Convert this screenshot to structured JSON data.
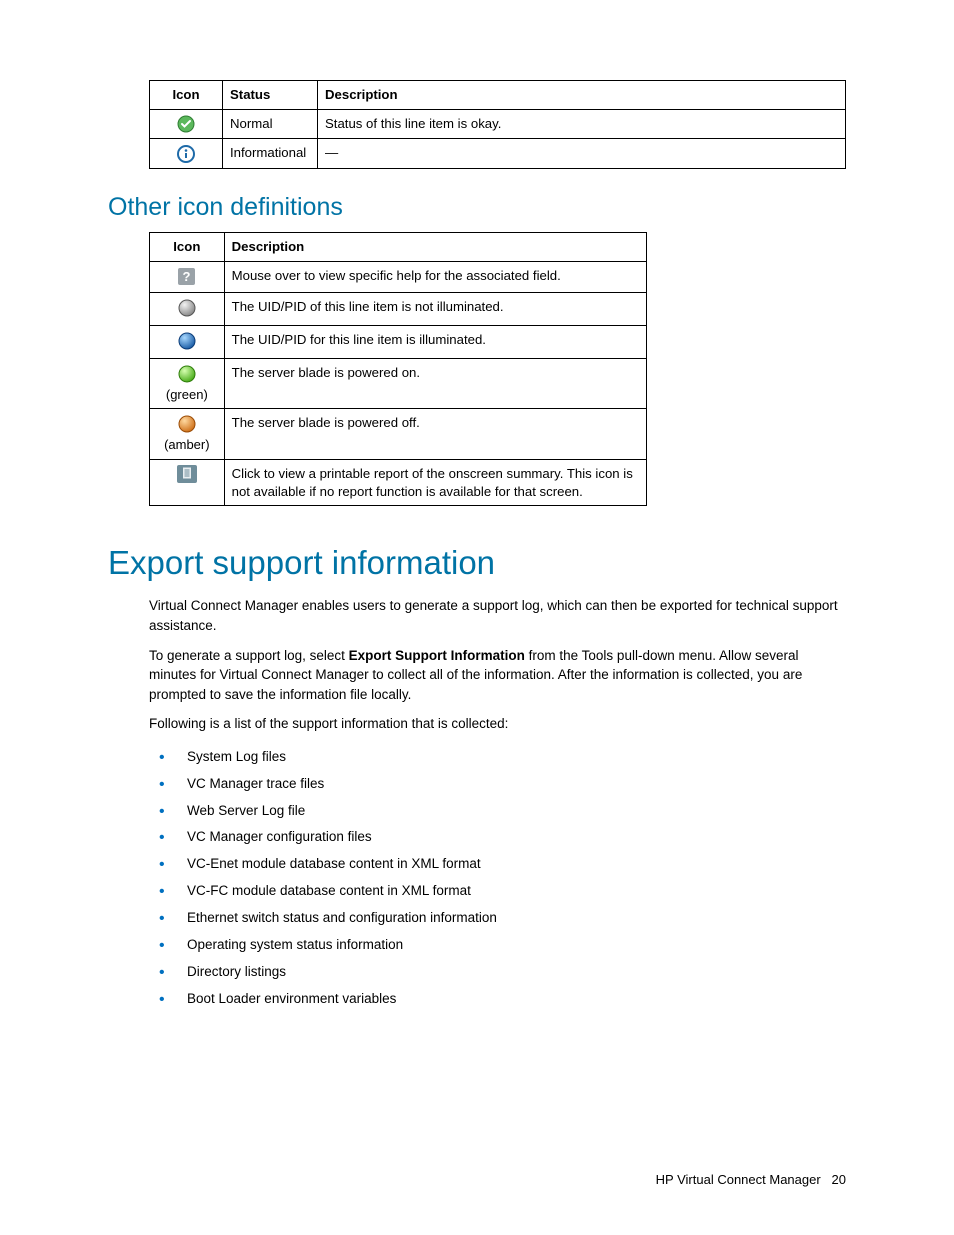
{
  "table1": {
    "headers": {
      "icon": "Icon",
      "status": "Status",
      "desc": "Description"
    },
    "rows": [
      {
        "status": "Normal",
        "desc": "Status of this line item is okay."
      },
      {
        "status": "Informational",
        "desc": "—"
      }
    ]
  },
  "section_other_title": "Other icon definitions",
  "table2": {
    "headers": {
      "icon": "Icon",
      "desc": "Description"
    },
    "rows": [
      {
        "note": "",
        "desc": "Mouse over to view specific help for the associated field."
      },
      {
        "note": "",
        "desc": "The UID/PID of this line item is not illuminated."
      },
      {
        "note": "",
        "desc": "The UID/PID for this line item is illuminated."
      },
      {
        "note": "(green)",
        "desc": "The server blade is powered on."
      },
      {
        "note": "(amber)",
        "desc": "The server blade is powered off."
      },
      {
        "note": "",
        "desc": "Click to view a printable report of the onscreen summary. This icon is not available if no report function is available for that screen."
      }
    ]
  },
  "section_export_title": "Export support information",
  "para1": "Virtual Connect Manager enables users to generate a support log, which can then be exported for technical support assistance.",
  "para2_pre": "To generate a support log, select ",
  "para2_bold": "Export Support Information",
  "para2_post": " from the Tools pull-down menu. Allow several minutes for Virtual Connect Manager to collect all of the information. After the information is collected, you are prompted to save the information file locally.",
  "para3": "Following is a list of the support information that is collected:",
  "bullets": [
    "System Log files",
    "VC Manager trace files",
    "Web Server Log file",
    "VC Manager configuration files",
    "VC-Enet module database content in XML format",
    "VC-FC module database content in XML format",
    "Ethernet switch status and configuration information",
    "Operating system status information",
    "Directory listings",
    "Boot Loader environment variables"
  ],
  "footer_text": "HP Virtual Connect Manager",
  "footer_page": "20"
}
